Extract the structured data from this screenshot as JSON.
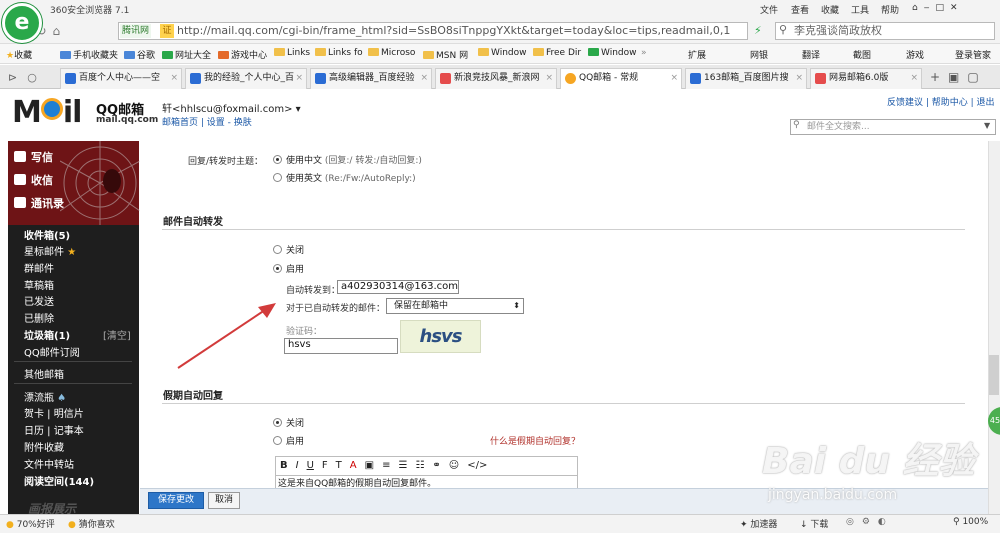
{
  "browser": {
    "title": "360安全浏览器 7.1",
    "menu": [
      "文件",
      "查看",
      "收藏",
      "工具",
      "帮助"
    ],
    "site_id": "腾讯网",
    "cert_label": "证",
    "url": "http://mail.qq.com/cgi-bin/frame_html?sid=SsBO8siTnppgYXkt&target=today&loc=tips,readmail,0,1",
    "search_placeholder": "李克强谈简政放权",
    "bookmarks": [
      "收藏",
      "手机收藏夹",
      "谷歌",
      "网址大全",
      "游戏中心",
      "Links",
      "Links fo",
      "Microso",
      "MSN 网",
      "Window",
      "Free Dir",
      "Window"
    ],
    "bookmark_right": [
      "扩展",
      "网银",
      "翻译",
      "截图",
      "游戏",
      "登录管家"
    ],
    "tabs": [
      "百度个人中心——空",
      "我的经验_个人中心_百",
      "高级编辑器_百度经验",
      "新浪竞技风暴_新浪网",
      "QQ邮箱 - 常规",
      "163邮箱_百度图片搜",
      "网易邮箱6.0版"
    ],
    "status": {
      "left": "70%好评",
      "guess": "猜你喜欢",
      "accel": "加速器",
      "download": "下载",
      "zoom": "100%"
    }
  },
  "mail": {
    "logo": "M",
    "logo_rest": "il",
    "brand": "QQ邮箱",
    "domain": "mail.qq.com",
    "user": "轩<hhlscu@foxmail.com>",
    "user_links": "邮箱首页 | 设置 - 换肤",
    "top_links": "反馈建议 | 帮助中心 | 退出",
    "search_placeholder": "邮件全文搜索...",
    "sidebar": {
      "write": "写信",
      "receive": "收信",
      "contacts": "通讯录",
      "inbox": "收件箱(5)",
      "starred": "星标邮件",
      "group": "群邮件",
      "drafts": "草稿箱",
      "sent": "已发送",
      "deleted": "已删除",
      "spam": "垃圾箱(1)",
      "clear": "[清空]",
      "subscribe": "QQ邮件订阅",
      "other": "其他邮箱",
      "bottle": "漂流瓶",
      "card": "贺卡 | 明信片",
      "calendar": "日历 | 记事本",
      "attach": "附件收藏",
      "transfer": "文件中转站",
      "reading": "阅读空间(144)",
      "brand_bottom": "画报展示"
    },
    "settings": {
      "reply_subject_label": "回复/转发时主题：",
      "reply_cn": "使用中文",
      "reply_cn_hint": "(回复:/ 转发:/自动回复:)",
      "reply_en": "使用英文",
      "reply_en_hint": "(Re:/Fw:/AutoReply:)",
      "forward_title": "邮件自动转发",
      "off": "关闭",
      "on": "启用",
      "forward_to_label": "自动转发到：",
      "forward_to": "a402930314@163.com",
      "handled_label": "对于已自动转发的邮件：",
      "handled_value": "保留在邮箱中",
      "captcha_label": "验证码：",
      "captcha_value": "hsvs",
      "captcha_img": "hsvs",
      "vacation_title": "假期自动回复",
      "vac_off": "关闭",
      "vac_on": "启用",
      "vac_help": "什么是假期自动回复？",
      "editor_text": "这是来自QQ邮箱的假期自动回复邮件。",
      "toolbar": [
        "B",
        "I",
        "U",
        "F",
        "T",
        "A",
        "▣",
        "≡",
        "☰",
        "☷",
        "⚭",
        "☺",
        "</>"
      ]
    },
    "save": "保存更改",
    "cancel": "取消"
  },
  "watermark": {
    "text": "Bai du 经验",
    "url": "jingyan.baidu.com"
  },
  "colors": {
    "accent": "#2d76c8",
    "sidebar": "#1e1e1e",
    "arrow": "#d23b3b"
  }
}
